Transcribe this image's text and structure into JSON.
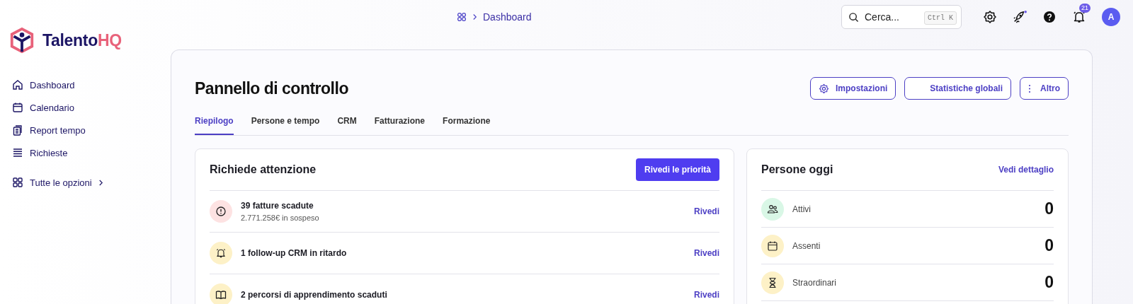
{
  "brand": {
    "name": "Talento",
    "accent": "HQ"
  },
  "sidebar": {
    "items": [
      {
        "label": "Dashboard",
        "kind": "home"
      },
      {
        "label": "Calendario",
        "kind": "calendar"
      },
      {
        "label": "Report tempo",
        "kind": "clipboard"
      },
      {
        "label": "Richieste",
        "kind": "list"
      }
    ],
    "more": "Tutte le opzioni"
  },
  "breadcrumb": {
    "current": "Dashboard"
  },
  "search": {
    "placeholder": "Cerca...",
    "shortcut": "Ctrl K"
  },
  "notifications": {
    "count": "21"
  },
  "avatar": "A",
  "page": {
    "title": "Pannello di controllo",
    "actions": [
      {
        "label": "Impostazioni",
        "kind": "gear"
      },
      {
        "label": "Statistiche globali",
        "kind": "blank"
      },
      {
        "label": "Altro",
        "kind": "dots"
      }
    ]
  },
  "tabs": [
    {
      "label": "Riepilogo",
      "selected": true
    },
    {
      "label": "Persone e tempo",
      "selected": false
    },
    {
      "label": "CRM",
      "selected": false
    },
    {
      "label": "Fatturazione",
      "selected": false
    },
    {
      "label": "Formazione",
      "selected": false
    }
  ],
  "attention": {
    "title": "Richiede attenzione",
    "button": "Rivedi le priorità",
    "items": [
      {
        "kind": "alert",
        "color": "#fde2e2",
        "title": "39 fatture scadute",
        "subtitle": "2.771.258€ in sospeso",
        "action": "Rivedi"
      },
      {
        "kind": "bell",
        "color": "#fdf1c7",
        "title": "1 follow-up CRM in ritardo",
        "action": "Rivedi"
      },
      {
        "kind": "book",
        "color": "#fdf1c7",
        "title": "2 percorsi di apprendimento scaduti",
        "action": "Rivedi"
      }
    ]
  },
  "people": {
    "title": "Persone oggi",
    "link": "Vedi dettaglio",
    "items": [
      {
        "kind": "people",
        "color": "#d9f7e6",
        "label": "Attivi",
        "value": "0"
      },
      {
        "kind": "calendar",
        "color": "#fdf1c7",
        "label": "Assenti",
        "value": "0"
      },
      {
        "kind": "hourglass",
        "color": "#fdf1c7",
        "label": "Straordinari",
        "value": "0"
      }
    ]
  }
}
